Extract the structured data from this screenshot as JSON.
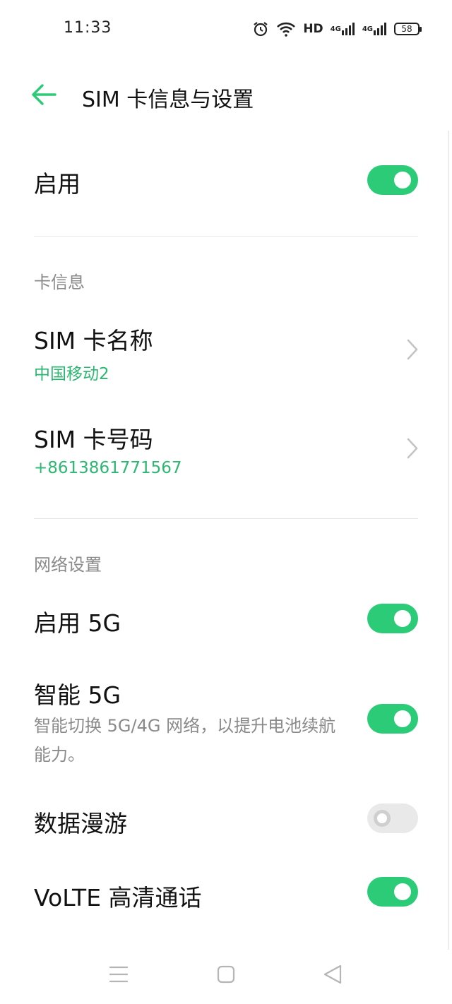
{
  "status_bar": {
    "time": "11:33",
    "hd": "HD",
    "network_1": "4G",
    "network_2": "4G",
    "battery": "58"
  },
  "header": {
    "title": "SIM 卡信息与设置"
  },
  "enable": {
    "label": "启用",
    "on": true
  },
  "card_info": {
    "section_label": "卡信息",
    "sim_name": {
      "label": "SIM 卡名称",
      "value": "中国移动2"
    },
    "sim_number": {
      "label": "SIM 卡号码",
      "value": "+8613861771567"
    }
  },
  "network_settings": {
    "section_label": "网络设置",
    "enable_5g": {
      "label": "启用 5G",
      "on": true
    },
    "smart_5g": {
      "label": "智能 5G",
      "description": "智能切换 5G/4G 网络，以提升电池续航能力。",
      "on": true
    },
    "data_roaming": {
      "label": "数据漫游",
      "on": false
    },
    "volte": {
      "label": "VoLTE 高清通话",
      "on": true
    }
  },
  "colors": {
    "accent": "#2ccb77",
    "accent_text": "#2cb872",
    "secondary_text": "#8a8a8a"
  },
  "icons": [
    "alarm-icon",
    "wifi-icon",
    "signal-icon",
    "battery-icon",
    "back-arrow-icon",
    "chevron-right-icon",
    "menu-icon",
    "home-icon",
    "back-icon"
  ]
}
